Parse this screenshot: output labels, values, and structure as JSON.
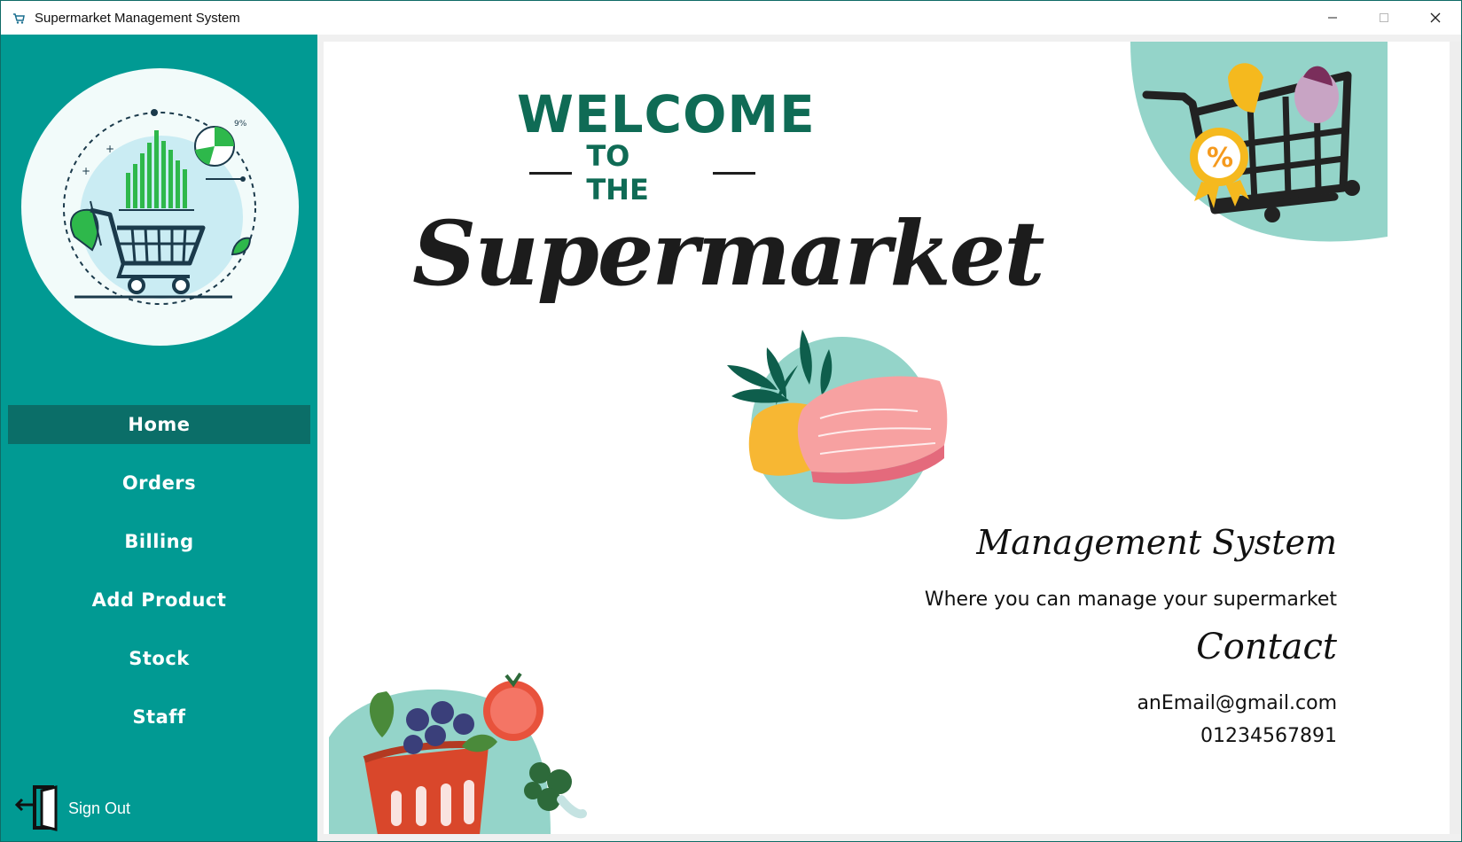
{
  "window": {
    "title": "Supermarket Management System",
    "minimize_icon": "minimize-icon",
    "maximize_icon": "maximize-icon",
    "close_icon": "close-icon"
  },
  "sidebar": {
    "background": "#019a93",
    "active_background": "#0b6e68",
    "items": [
      {
        "label": "Home",
        "active": true
      },
      {
        "label": "Orders",
        "active": false
      },
      {
        "label": "Billing",
        "active": false
      },
      {
        "label": "Add Product",
        "active": false
      },
      {
        "label": "Stock",
        "active": false
      },
      {
        "label": "Staff",
        "active": false
      }
    ],
    "sign_out": {
      "label": "Sign Out",
      "icon": "door-exit-icon"
    }
  },
  "main": {
    "welcome": "WELCOME",
    "to_the": "TO THE",
    "brand": "Supermarket",
    "subtitle": "Management System",
    "tagline": "Where you can manage your supermarket",
    "contact_title": "Contact",
    "email": "anEmail@gmail.com",
    "phone": "01234567891",
    "accent_color": "#0f6b55"
  }
}
